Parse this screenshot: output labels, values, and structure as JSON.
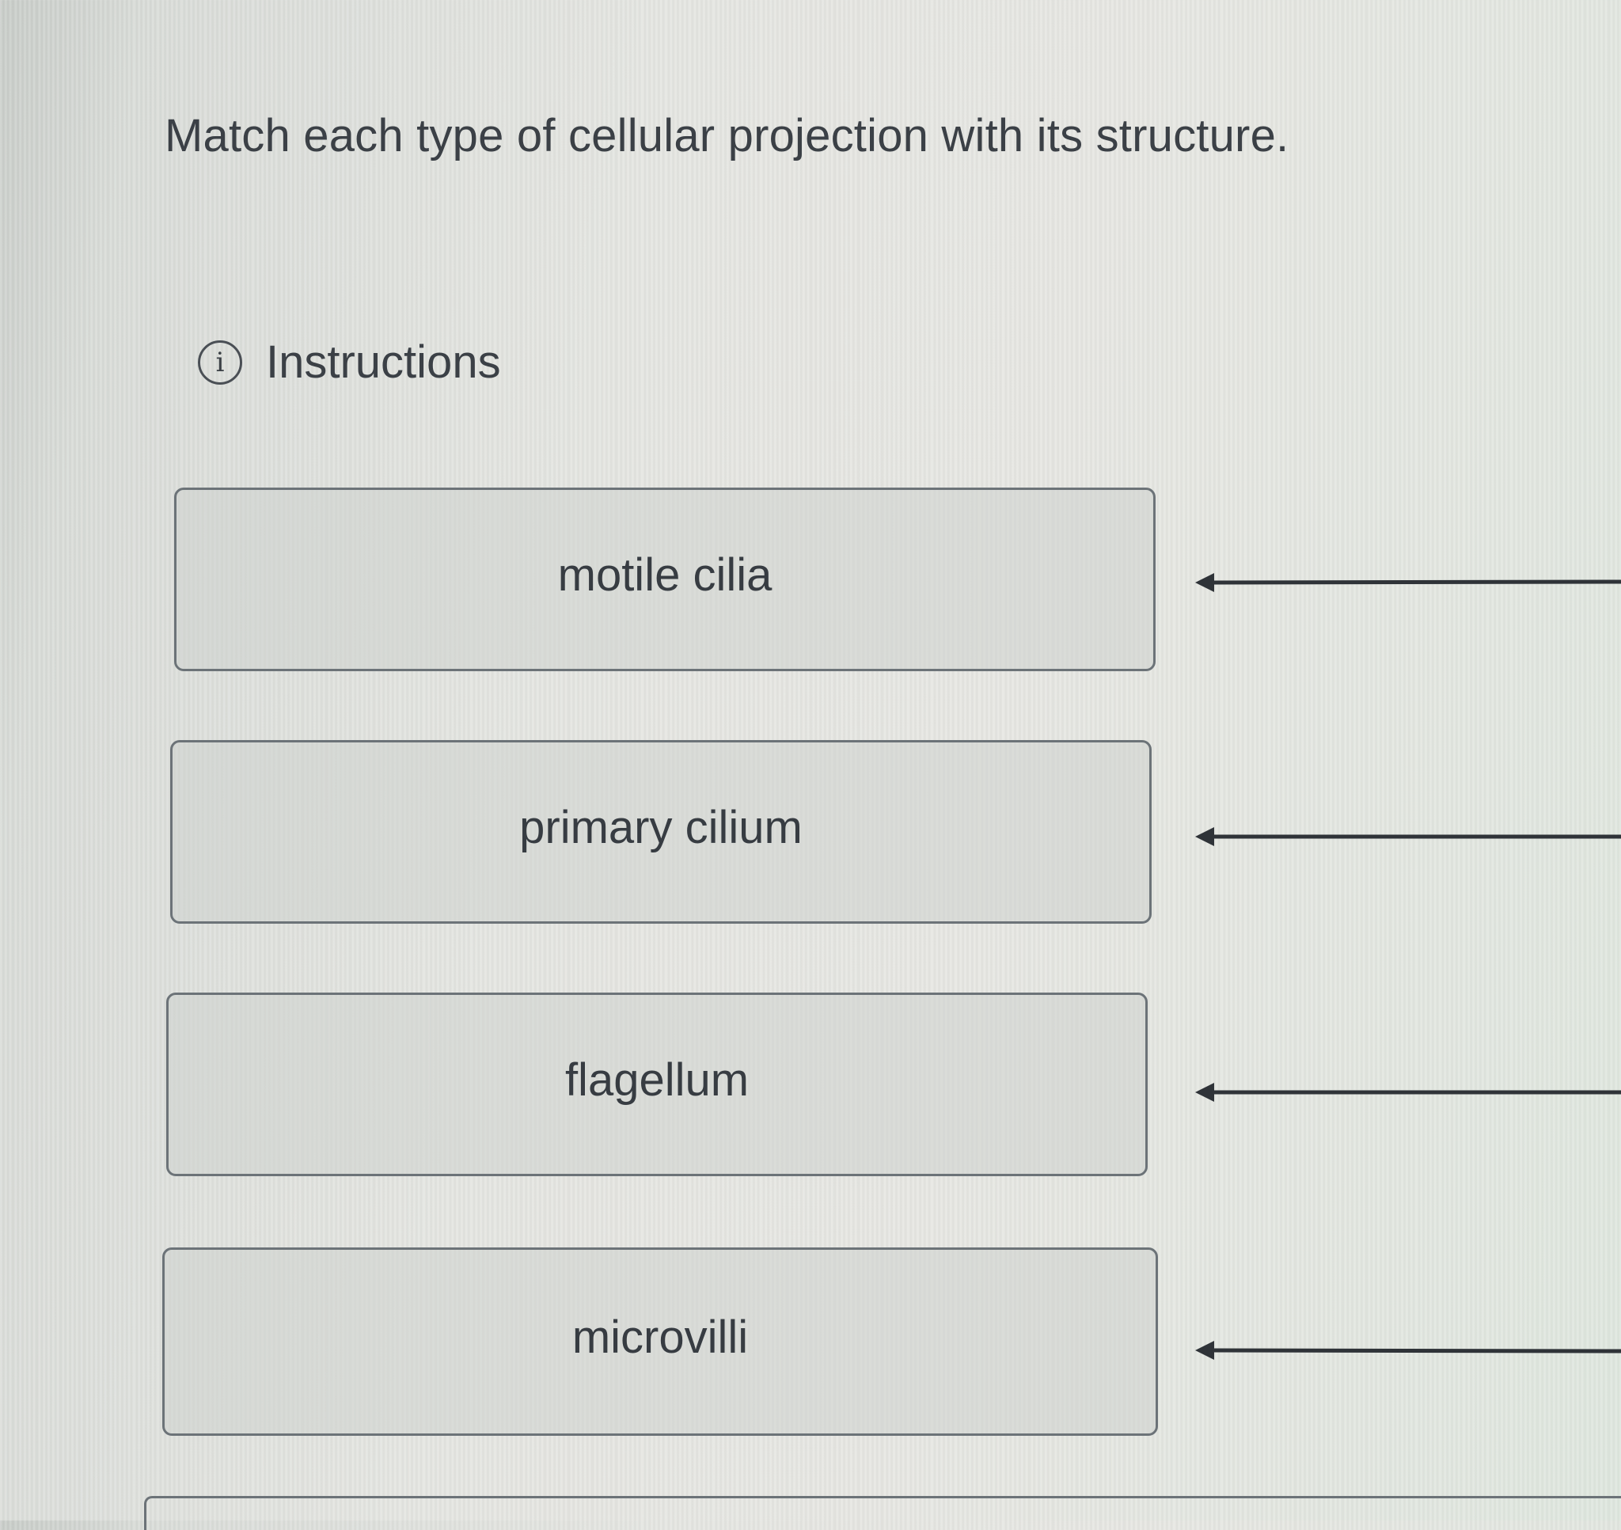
{
  "question": {
    "text": "Match each type of cellular projection with its structure."
  },
  "instructions": {
    "icon_glyph": "i",
    "icon": "info-circle-icon",
    "label": "Instructions"
  },
  "terms": [
    {
      "label": "motile cilia"
    },
    {
      "label": "primary cilium"
    },
    {
      "label": "flagellum"
    },
    {
      "label": "microvilli"
    }
  ]
}
